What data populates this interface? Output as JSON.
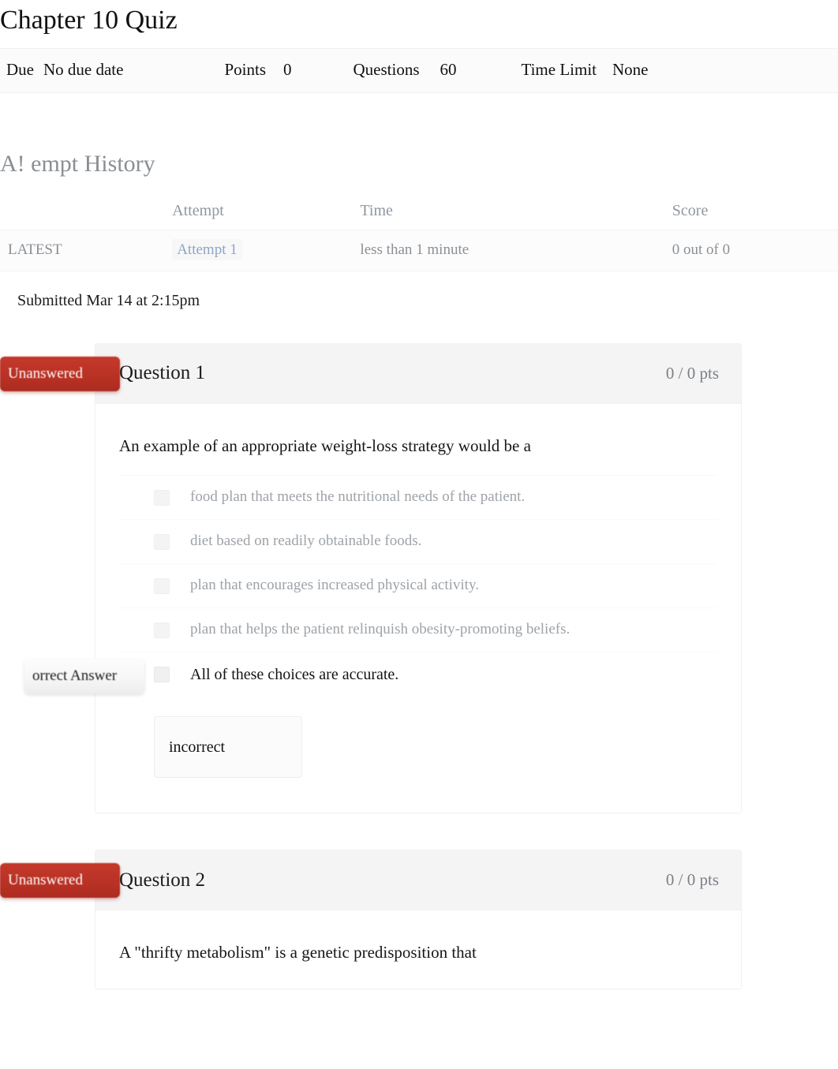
{
  "page": {
    "title": "Chapter 10 Quiz"
  },
  "meta": {
    "due_label": "Due",
    "due_value": "No due date",
    "points_label": "Points",
    "points_value": "0",
    "questions_label": "Questions",
    "questions_value": "60",
    "time_limit_label": "Time Limit",
    "time_limit_value": "None"
  },
  "attempt_history": {
    "heading": "A! empt History",
    "columns": [
      "",
      "Attempt",
      "Time",
      "Score"
    ],
    "rows": [
      {
        "kept": "LATEST",
        "attempt": "Attempt 1",
        "time": "less than 1 minute",
        "score": "0 out of 0"
      }
    ],
    "submitted": "Submitted Mar 14 at 2:15pm"
  },
  "questions": [
    {
      "badge": "Unanswered",
      "name": "Question 1",
      "points": "0 / 0 pts",
      "text": "An example of an appropriate weight-loss strategy would be a",
      "answers": [
        {
          "text": "food plan that meets the nutritional needs of the patient.",
          "correct": false,
          "badge": ""
        },
        {
          "text": "diet based on readily obtainable foods.",
          "correct": false,
          "badge": ""
        },
        {
          "text": "plan that encourages increased physical activity.",
          "correct": false,
          "badge": ""
        },
        {
          "text": "plan that helps the patient relinquish obesity-promoting beliefs.",
          "correct": false,
          "badge": ""
        },
        {
          "text": "All of these choices are accurate.",
          "correct": true,
          "badge": "orrect Answer"
        }
      ],
      "comment": "incorrect"
    },
    {
      "badge": "Unanswered",
      "name": "Question 2",
      "points": "0 / 0 pts",
      "text": "A \"thrifty metabolism\" is a genetic predisposition that",
      "answers": [],
      "comment": ""
    }
  ],
  "colors": {
    "unanswered_badge": "#b93225",
    "correct_badge": "#f6f6f6",
    "link": "#8fa4c4",
    "heading_muted": "#8a8f94"
  }
}
